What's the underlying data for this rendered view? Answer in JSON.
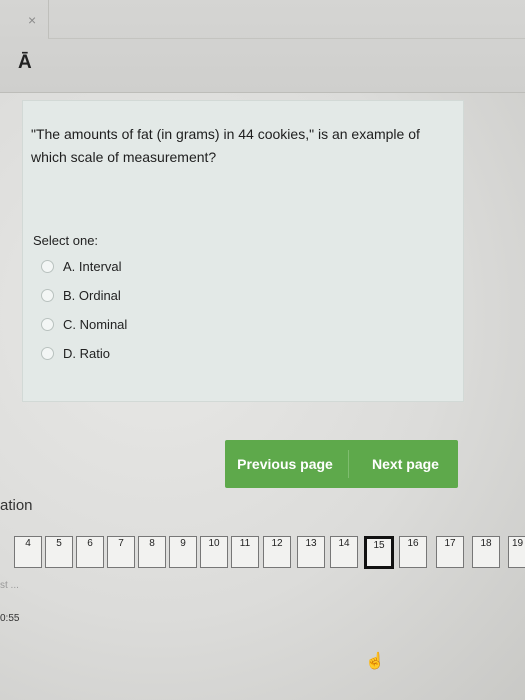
{
  "window": {
    "close_glyph": "×",
    "toolbar_icon_text": "Ā"
  },
  "question": {
    "text": "\"The amounts of fat (in grams) in 44 cookies,\" is an example of which scale of measurement?",
    "prompt": "Select one:",
    "options": [
      {
        "label": "A. Interval"
      },
      {
        "label": "B. Ordinal"
      },
      {
        "label": "C. Nominal"
      },
      {
        "label": "D. Ratio"
      }
    ]
  },
  "navigation": {
    "previous_label": "Previous page",
    "next_label": "Next page",
    "accent_color": "#5ea94b"
  },
  "quiz_navigation": {
    "title_fragment": "ation",
    "pages": [
      "4",
      "5",
      "6",
      "7",
      "8",
      "9",
      "10",
      "11",
      "12",
      "13",
      "14",
      "15",
      "16",
      "17",
      "18",
      "19"
    ],
    "current_page": "15"
  },
  "footer": {
    "small_text": "st ...",
    "timer": "0:55"
  }
}
